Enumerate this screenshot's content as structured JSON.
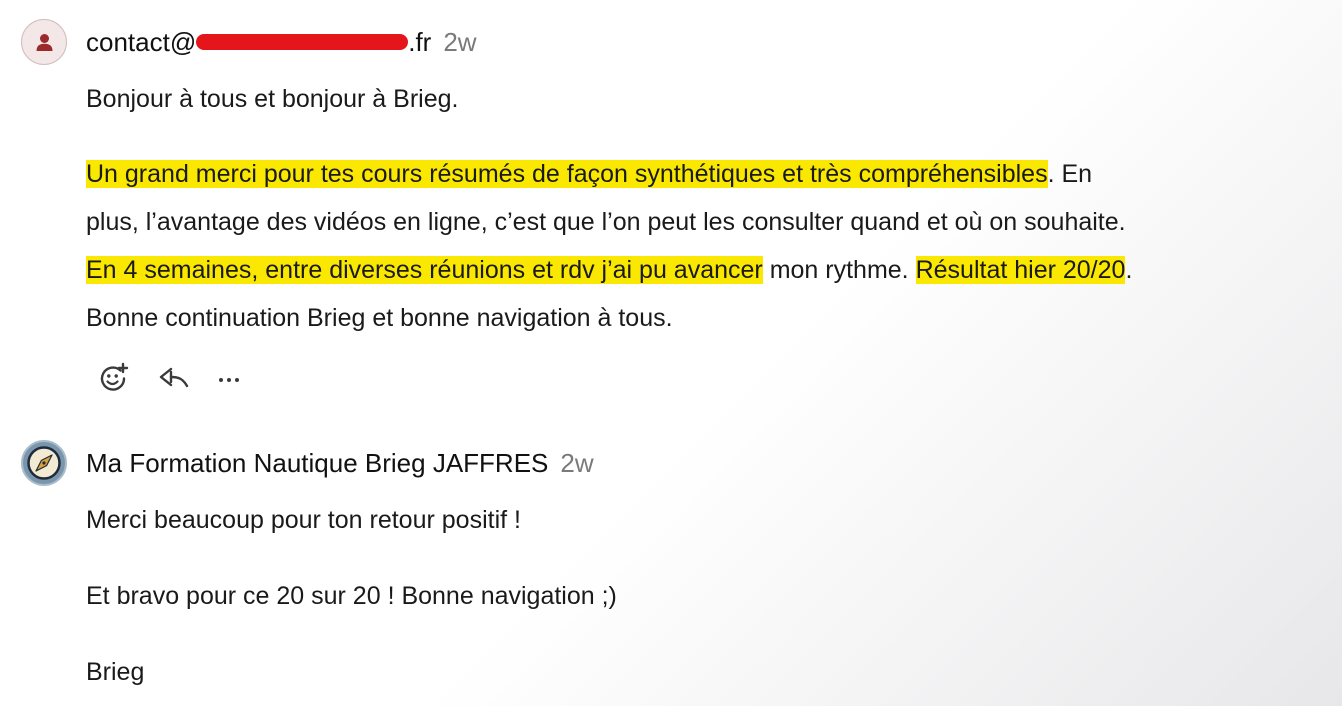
{
  "comments": [
    {
      "author_prefix": "contact@",
      "author_suffix": ".fr",
      "time": "2w",
      "greeting": "Bonjour à tous et bonjour à Brieg.",
      "p2": {
        "h1": "Un grand merci pour tes cours résumés de façon synthétiques et très compréhensibles",
        "t1": ". En",
        "l2": "plus, l’avantage des vidéos en ligne, c’est que l’on peut les consulter quand et où on souhaite.",
        "h2": "En 4 semaines, entre diverses réunions et rdv j’ai pu avancer",
        "t2": " mon rythme. ",
        "h3": "Résultat hier 20/20",
        "t3": ".",
        "l4": "Bonne continuation Brieg et bonne navigation à tous."
      },
      "actions": {
        "react_icon": "add-reaction-icon",
        "reply_icon": "reply-icon",
        "more_icon": "more-options-icon"
      }
    },
    {
      "author": "Ma Formation Nautique Brieg JAFFRES",
      "time": "2w",
      "lines": [
        "Merci beaucoup pour ton retour positif !",
        "Et bravo pour ce 20 sur 20 ! Bonne navigation ;)",
        "Brieg"
      ]
    }
  ],
  "colors": {
    "highlight": "#fbe800",
    "redaction": "#e4161c",
    "timestamp": "#7a7a7a"
  }
}
